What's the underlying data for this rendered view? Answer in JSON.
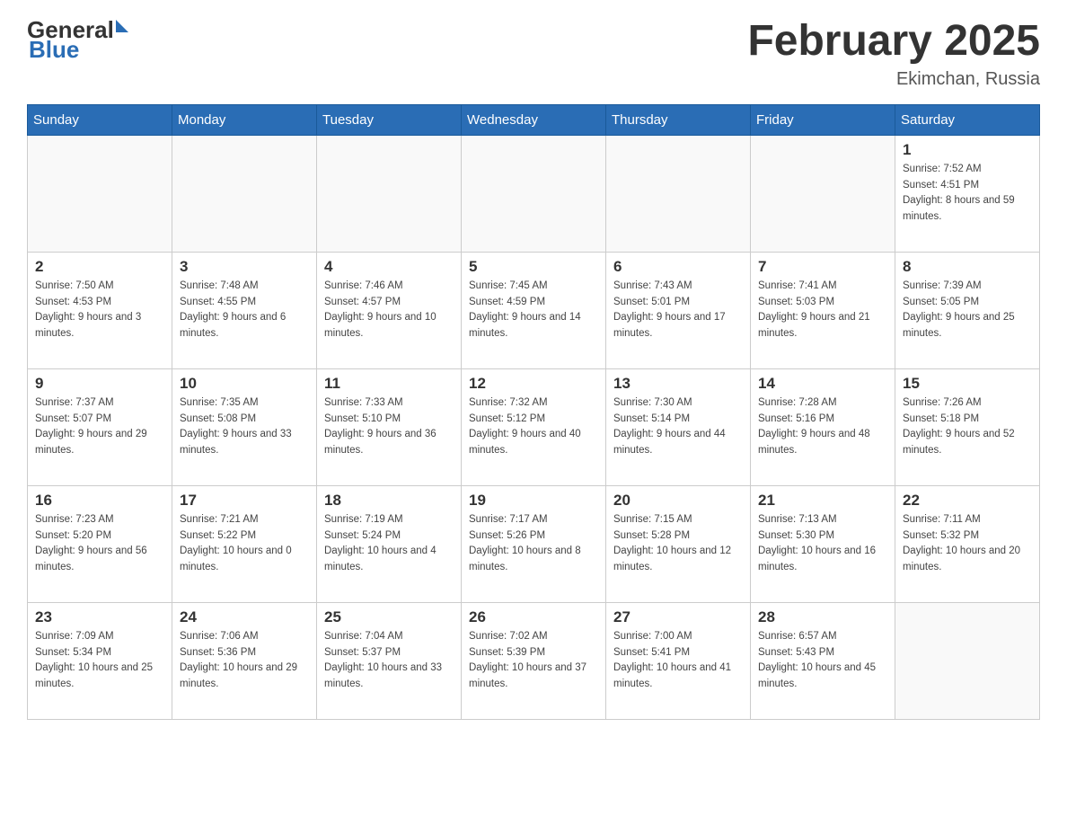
{
  "logo": {
    "text_general": "General",
    "text_blue": "Blue",
    "alt": "GeneralBlue logo"
  },
  "header": {
    "month_year": "February 2025",
    "location": "Ekimchan, Russia"
  },
  "weekdays": [
    "Sunday",
    "Monday",
    "Tuesday",
    "Wednesday",
    "Thursday",
    "Friday",
    "Saturday"
  ],
  "weeks": [
    [
      {
        "day": "",
        "sunrise": "",
        "sunset": "",
        "daylight": ""
      },
      {
        "day": "",
        "sunrise": "",
        "sunset": "",
        "daylight": ""
      },
      {
        "day": "",
        "sunrise": "",
        "sunset": "",
        "daylight": ""
      },
      {
        "day": "",
        "sunrise": "",
        "sunset": "",
        "daylight": ""
      },
      {
        "day": "",
        "sunrise": "",
        "sunset": "",
        "daylight": ""
      },
      {
        "day": "",
        "sunrise": "",
        "sunset": "",
        "daylight": ""
      },
      {
        "day": "1",
        "sunrise": "Sunrise: 7:52 AM",
        "sunset": "Sunset: 4:51 PM",
        "daylight": "Daylight: 8 hours and 59 minutes."
      }
    ],
    [
      {
        "day": "2",
        "sunrise": "Sunrise: 7:50 AM",
        "sunset": "Sunset: 4:53 PM",
        "daylight": "Daylight: 9 hours and 3 minutes."
      },
      {
        "day": "3",
        "sunrise": "Sunrise: 7:48 AM",
        "sunset": "Sunset: 4:55 PM",
        "daylight": "Daylight: 9 hours and 6 minutes."
      },
      {
        "day": "4",
        "sunrise": "Sunrise: 7:46 AM",
        "sunset": "Sunset: 4:57 PM",
        "daylight": "Daylight: 9 hours and 10 minutes."
      },
      {
        "day": "5",
        "sunrise": "Sunrise: 7:45 AM",
        "sunset": "Sunset: 4:59 PM",
        "daylight": "Daylight: 9 hours and 14 minutes."
      },
      {
        "day": "6",
        "sunrise": "Sunrise: 7:43 AM",
        "sunset": "Sunset: 5:01 PM",
        "daylight": "Daylight: 9 hours and 17 minutes."
      },
      {
        "day": "7",
        "sunrise": "Sunrise: 7:41 AM",
        "sunset": "Sunset: 5:03 PM",
        "daylight": "Daylight: 9 hours and 21 minutes."
      },
      {
        "day": "8",
        "sunrise": "Sunrise: 7:39 AM",
        "sunset": "Sunset: 5:05 PM",
        "daylight": "Daylight: 9 hours and 25 minutes."
      }
    ],
    [
      {
        "day": "9",
        "sunrise": "Sunrise: 7:37 AM",
        "sunset": "Sunset: 5:07 PM",
        "daylight": "Daylight: 9 hours and 29 minutes."
      },
      {
        "day": "10",
        "sunrise": "Sunrise: 7:35 AM",
        "sunset": "Sunset: 5:08 PM",
        "daylight": "Daylight: 9 hours and 33 minutes."
      },
      {
        "day": "11",
        "sunrise": "Sunrise: 7:33 AM",
        "sunset": "Sunset: 5:10 PM",
        "daylight": "Daylight: 9 hours and 36 minutes."
      },
      {
        "day": "12",
        "sunrise": "Sunrise: 7:32 AM",
        "sunset": "Sunset: 5:12 PM",
        "daylight": "Daylight: 9 hours and 40 minutes."
      },
      {
        "day": "13",
        "sunrise": "Sunrise: 7:30 AM",
        "sunset": "Sunset: 5:14 PM",
        "daylight": "Daylight: 9 hours and 44 minutes."
      },
      {
        "day": "14",
        "sunrise": "Sunrise: 7:28 AM",
        "sunset": "Sunset: 5:16 PM",
        "daylight": "Daylight: 9 hours and 48 minutes."
      },
      {
        "day": "15",
        "sunrise": "Sunrise: 7:26 AM",
        "sunset": "Sunset: 5:18 PM",
        "daylight": "Daylight: 9 hours and 52 minutes."
      }
    ],
    [
      {
        "day": "16",
        "sunrise": "Sunrise: 7:23 AM",
        "sunset": "Sunset: 5:20 PM",
        "daylight": "Daylight: 9 hours and 56 minutes."
      },
      {
        "day": "17",
        "sunrise": "Sunrise: 7:21 AM",
        "sunset": "Sunset: 5:22 PM",
        "daylight": "Daylight: 10 hours and 0 minutes."
      },
      {
        "day": "18",
        "sunrise": "Sunrise: 7:19 AM",
        "sunset": "Sunset: 5:24 PM",
        "daylight": "Daylight: 10 hours and 4 minutes."
      },
      {
        "day": "19",
        "sunrise": "Sunrise: 7:17 AM",
        "sunset": "Sunset: 5:26 PM",
        "daylight": "Daylight: 10 hours and 8 minutes."
      },
      {
        "day": "20",
        "sunrise": "Sunrise: 7:15 AM",
        "sunset": "Sunset: 5:28 PM",
        "daylight": "Daylight: 10 hours and 12 minutes."
      },
      {
        "day": "21",
        "sunrise": "Sunrise: 7:13 AM",
        "sunset": "Sunset: 5:30 PM",
        "daylight": "Daylight: 10 hours and 16 minutes."
      },
      {
        "day": "22",
        "sunrise": "Sunrise: 7:11 AM",
        "sunset": "Sunset: 5:32 PM",
        "daylight": "Daylight: 10 hours and 20 minutes."
      }
    ],
    [
      {
        "day": "23",
        "sunrise": "Sunrise: 7:09 AM",
        "sunset": "Sunset: 5:34 PM",
        "daylight": "Daylight: 10 hours and 25 minutes."
      },
      {
        "day": "24",
        "sunrise": "Sunrise: 7:06 AM",
        "sunset": "Sunset: 5:36 PM",
        "daylight": "Daylight: 10 hours and 29 minutes."
      },
      {
        "day": "25",
        "sunrise": "Sunrise: 7:04 AM",
        "sunset": "Sunset: 5:37 PM",
        "daylight": "Daylight: 10 hours and 33 minutes."
      },
      {
        "day": "26",
        "sunrise": "Sunrise: 7:02 AM",
        "sunset": "Sunset: 5:39 PM",
        "daylight": "Daylight: 10 hours and 37 minutes."
      },
      {
        "day": "27",
        "sunrise": "Sunrise: 7:00 AM",
        "sunset": "Sunset: 5:41 PM",
        "daylight": "Daylight: 10 hours and 41 minutes."
      },
      {
        "day": "28",
        "sunrise": "Sunrise: 6:57 AM",
        "sunset": "Sunset: 5:43 PM",
        "daylight": "Daylight: 10 hours and 45 minutes."
      },
      {
        "day": "",
        "sunrise": "",
        "sunset": "",
        "daylight": ""
      }
    ]
  ]
}
